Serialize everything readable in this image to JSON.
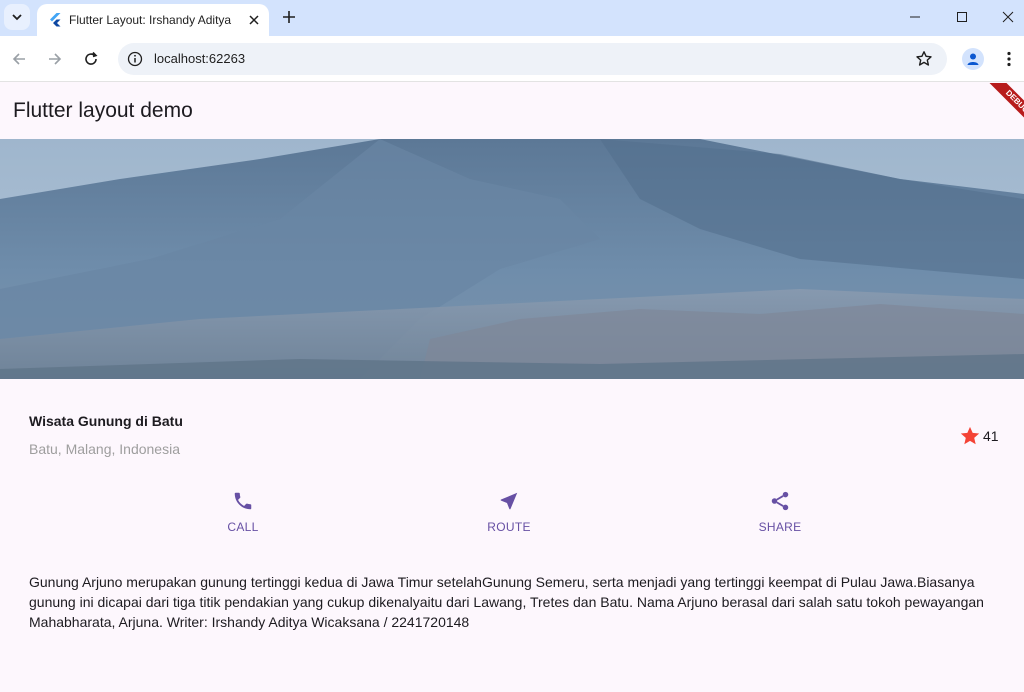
{
  "browser": {
    "tab_title": "Flutter Layout: Irshandy Aditya",
    "url": "localhost:62263"
  },
  "app": {
    "title": "Flutter layout demo",
    "debug_label": "DEBUG",
    "place_name": "Wisata Gunung di Batu",
    "place_location": "Batu, Malang, Indonesia",
    "rating_count": "41",
    "actions": [
      {
        "label": "CALL",
        "icon": "phone-icon"
      },
      {
        "label": "ROUTE",
        "icon": "navigation-icon"
      },
      {
        "label": "SHARE",
        "icon": "share-icon"
      }
    ],
    "description": "Gunung Arjuno merupakan gunung tertinggi kedua di Jawa Timur setelahGunung Semeru, serta menjadi yang tertinggi keempat di Pulau Jawa.Biasanya gunung ini dicapai dari tiga titik pendakian yang cukup dikenalyaitu dari Lawang, Tretes dan Batu. Nama Arjuno berasal dari salah satu tokoh pewayangan Mahabharata, Arjuna. Writer: Irshandy Aditya Wicaksana / 2241720148"
  },
  "colors": {
    "accent": "#6750a4",
    "star": "#f44336",
    "background": "#fdf7fd"
  }
}
